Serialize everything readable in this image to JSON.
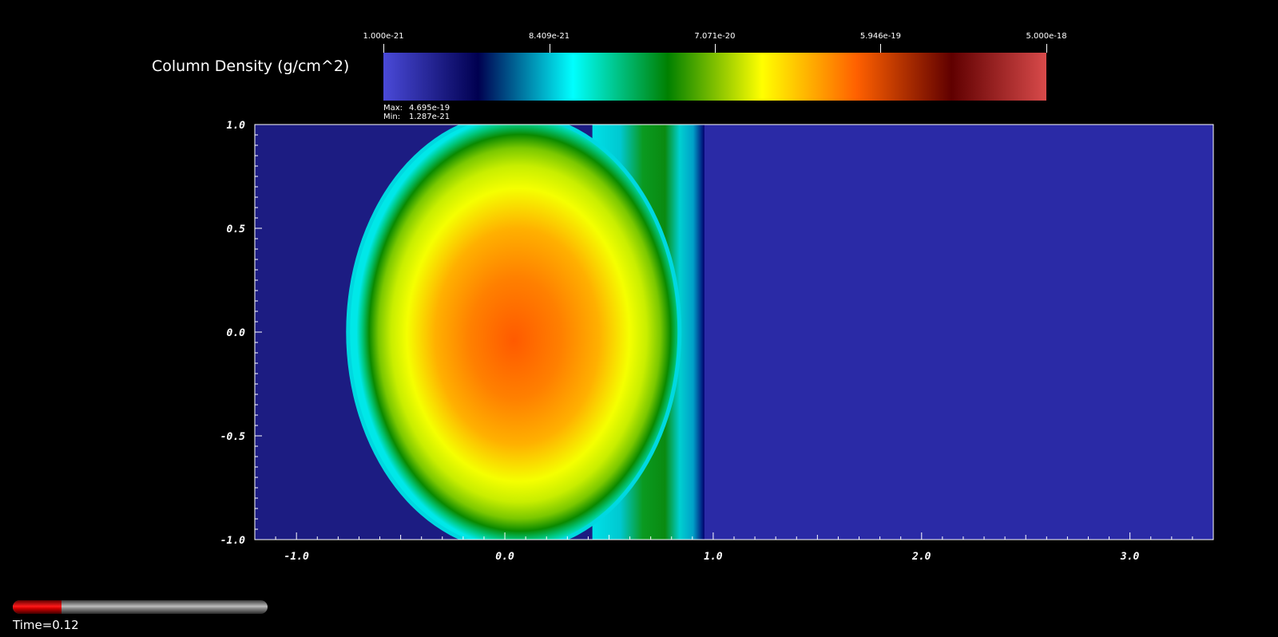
{
  "chart_data": {
    "type": "heatmap",
    "title": "Column Density (g/cm^2)",
    "colorbar": {
      "tick_labels": [
        "1.000e-21",
        "8.409e-21",
        "7.071e-20",
        "5.946e-19",
        "5.000e-18"
      ],
      "range": [
        1e-21,
        5e-18
      ],
      "scale": "log",
      "colormap": [
        "#4a4ad8",
        "#000050",
        "#00ffff",
        "#008000",
        "#ffff00",
        "#ff6000",
        "#600000",
        "#d84a4a"
      ]
    },
    "max_label": "Max:",
    "max_value": "4.695e-19",
    "min_label": "Min:",
    "min_value": "1.287e-21",
    "x_ticks": [
      "-1.0",
      "0.0",
      "1.0",
      "2.0",
      "3.0"
    ],
    "x_tick_values": [
      -1.0,
      0.0,
      1.0,
      2.0,
      3.0
    ],
    "y_ticks": [
      "1.0",
      "0.5",
      "0.0",
      "-0.5",
      "-1.0"
    ],
    "y_tick_values": [
      1.0,
      0.5,
      0.0,
      -0.5,
      -1.0
    ],
    "xlim": [
      -1.2,
      3.4
    ],
    "ylim": [
      -1.0,
      1.0
    ],
    "background_color": "#26269a",
    "features": {
      "cloud_center": [
        0.02,
        0.0
      ],
      "cloud_core_color": "#ff6400",
      "shock_front_x": 0.95
    }
  },
  "time": {
    "label": "Time=0.12",
    "fraction": 0.19,
    "fill_color": "#ff0000"
  }
}
